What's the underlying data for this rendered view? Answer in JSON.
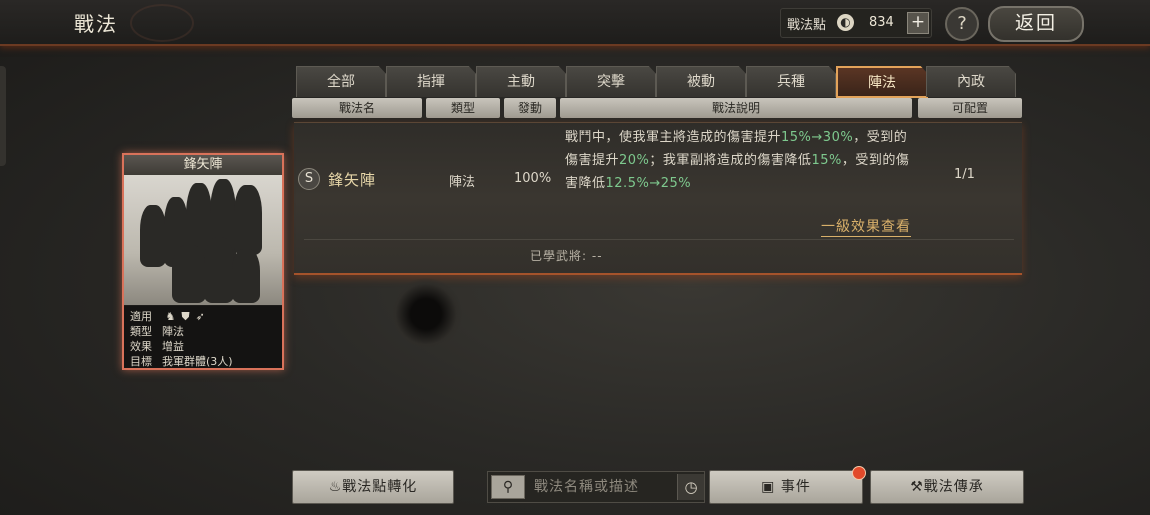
{
  "header": {
    "title": "戰法",
    "points_label": "戰法點",
    "points_value": "834",
    "plus_label": "+",
    "help_label": "?",
    "back_label": "返回"
  },
  "tabs": [
    {
      "label": "全部"
    },
    {
      "label": "指揮"
    },
    {
      "label": "主動"
    },
    {
      "label": "突擊"
    },
    {
      "label": "被動"
    },
    {
      "label": "兵種"
    },
    {
      "label": "陣法",
      "active": true
    },
    {
      "label": "內政"
    }
  ],
  "columns": {
    "name": "戰法名",
    "type": "類型",
    "rate": "發動",
    "desc": "戰法說明",
    "config": "可配置"
  },
  "skill": {
    "grade": "S",
    "name": "鋒矢陣",
    "type": "陣法",
    "rate": "100%",
    "desc_parts": [
      {
        "t": "戰鬥中，使我軍主將造成的傷害提升"
      },
      {
        "t": "15%→30%",
        "g": true
      },
      {
        "t": "，受到的傷害提升"
      },
      {
        "t": "20%",
        "g": true
      },
      {
        "t": "；我軍副將造成的傷害降低"
      },
      {
        "t": "15%",
        "g": true
      },
      {
        "t": "，受到的傷害降低"
      },
      {
        "t": "12.5%→25%",
        "g": true
      }
    ],
    "config": "1/1",
    "effect_link": "一級效果查看",
    "learned_label": "已學武將:",
    "learned_value": "--"
  },
  "card": {
    "title": "鋒矢陣",
    "applies_label": "適用",
    "applies_icons": [
      "cavalry-icon",
      "shield-icon",
      "archer-icon"
    ],
    "type_label": "類型",
    "type_value": "陣法",
    "effect_label": "效果",
    "effect_value": "增益",
    "target_label": "目標",
    "target_value": "我軍群體(3人)"
  },
  "bottom": {
    "convert_label": "戰法點轉化",
    "search_placeholder": "戰法名稱或描述",
    "events_label": "事件",
    "inherit_label": "戰法傳承"
  }
}
